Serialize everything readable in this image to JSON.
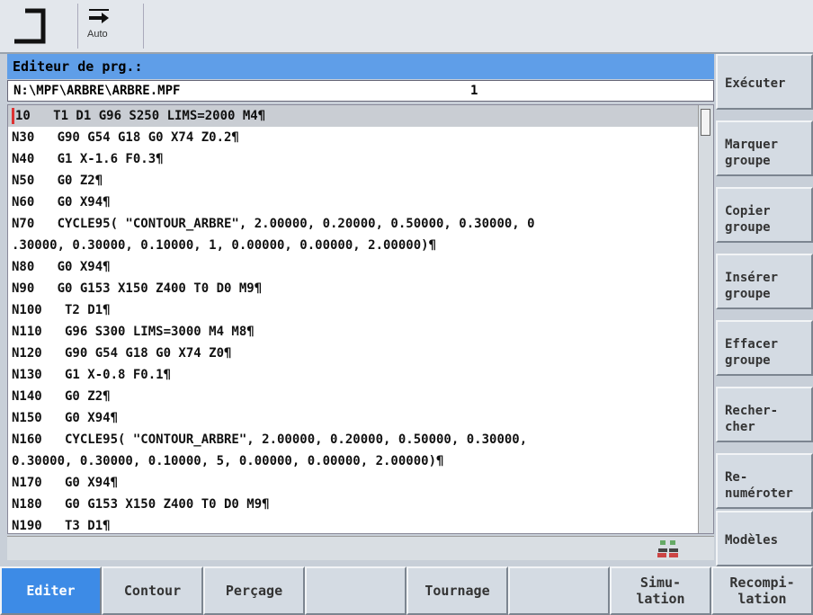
{
  "toolbar": {
    "auto_label": "Auto"
  },
  "editor": {
    "title": "Editeur de prg.:",
    "path": "N:\\MPF\\ARBRE\\ARBRE.MPF",
    "channel_number": "1"
  },
  "code_lines": [
    "10   T1 D1 G96 S250 LIMS=2000 M4¶",
    "N30   G90 G54 G18 G0 X74 Z0.2¶",
    "N40   G1 X-1.6 F0.3¶",
    "N50   G0 Z2¶",
    "N60   G0 X94¶",
    "N70   CYCLE95( \"CONTOUR_ARBRE\", 2.00000, 0.20000, 0.50000, 0.30000, 0",
    ".30000, 0.30000, 0.10000, 1, 0.00000, 0.00000, 2.00000)¶",
    "N80   G0 X94¶",
    "N90   G0 G153 X150 Z400 T0 D0 M9¶",
    "N100   T2 D1¶",
    "N110   G96 S300 LIMS=3000 M4 M8¶",
    "N120   G90 G54 G18 G0 X74 Z0¶",
    "N130   G1 X-0.8 F0.1¶",
    "N140   G0 Z2¶",
    "N150   G0 X94¶",
    "N160   CYCLE95( \"CONTOUR_ARBRE\", 2.00000, 0.20000, 0.50000, 0.30000,",
    "0.30000, 0.30000, 0.10000, 5, 0.00000, 0.00000, 2.00000)¶",
    "N170   G0 X94¶",
    "N180   G0 G153 X150 Z400 T0 D0 M9¶",
    "N190   T3 D1¶"
  ],
  "side_softkeys": [
    "Exécuter",
    "Marquer\ngroupe",
    "Copier\ngroupe",
    "Insérer\ngroupe",
    "Effacer\ngroupe",
    "Recher-\ncher",
    "Re-\nnuméroter",
    "Modèles"
  ],
  "bottom_softkeys": [
    "Editer",
    "Contour",
    "Perçage",
    "",
    "Tournage",
    "",
    "Simu-\nlation",
    "Recompi-\nlation"
  ],
  "colors": {
    "accent": "#3d8be6",
    "header": "#5f9ee8"
  }
}
